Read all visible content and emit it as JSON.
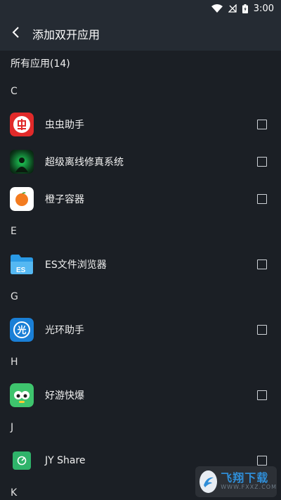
{
  "status_bar": {
    "time": "3:00"
  },
  "toolbar": {
    "title": "添加双开应用"
  },
  "all_apps_label": "所有应用(14)",
  "sections": [
    {
      "letter": "C",
      "apps": [
        {
          "name": "虫虫助手",
          "icon": "chongchong-icon",
          "checked": false
        },
        {
          "name": "超级离线修真系统",
          "icon": "xiuzhen-icon",
          "checked": false
        },
        {
          "name": "橙子容器",
          "icon": "orange-icon",
          "checked": false
        }
      ]
    },
    {
      "letter": "E",
      "apps": [
        {
          "name": "ES文件浏览器",
          "icon": "es-folder-icon",
          "checked": false
        }
      ]
    },
    {
      "letter": "G",
      "apps": [
        {
          "name": "光环助手",
          "icon": "guanghuan-icon",
          "checked": false
        }
      ]
    },
    {
      "letter": "H",
      "apps": [
        {
          "name": "好游快爆",
          "icon": "haoyou-icon",
          "checked": false
        }
      ]
    },
    {
      "letter": "J",
      "apps": [
        {
          "name": "JY Share",
          "icon": "jyshare-icon",
          "checked": false
        }
      ]
    },
    {
      "letter": "K",
      "apps": []
    }
  ],
  "watermark": {
    "main": "飞翔下载",
    "sub": "WWW.FXXZ.COM"
  }
}
